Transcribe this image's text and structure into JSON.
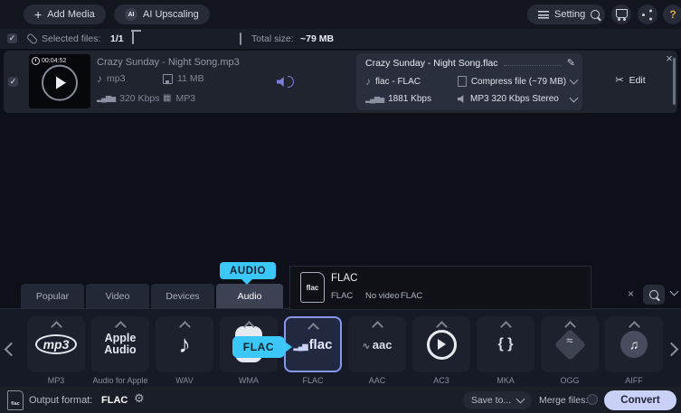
{
  "topbar": {
    "add_media": "Add Media",
    "ai_badge": "AI",
    "ai_upscaling": "AI Upscaling",
    "settings": "Settings",
    "help": "?"
  },
  "selection_bar": {
    "selected_files_label": "Selected files:",
    "selected_files_value": "1/1",
    "total_size_label": "Total size:",
    "total_size_value": "~79 MB"
  },
  "file_row": {
    "duration": "00:04:52",
    "title": "Crazy Sunday - Night Song.mp3",
    "format": "mp3",
    "size": "11 MB",
    "bitrate": "320 Kbps",
    "codec": "MP3"
  },
  "output_panel": {
    "filename": "Crazy Sunday - Night Song.flac",
    "format": "flac - FLAC",
    "compress": "Compress file (~79 MB)",
    "bitrate": "1881 Kbps",
    "audio_preset": "MP3 320 Kbps Stereo",
    "edit_label": "Edit",
    "close": "×"
  },
  "callouts": {
    "audio": "AUDIO",
    "flac": "FLAC"
  },
  "tabs": [
    {
      "label": "Popular",
      "active": false
    },
    {
      "label": "Video",
      "active": false
    },
    {
      "label": "Devices",
      "active": false
    },
    {
      "label": "Audio",
      "active": true
    }
  ],
  "format_tooltip": {
    "icon_label": "flac",
    "title": "FLAC",
    "container": "FLAC",
    "video": "No video",
    "audio": "FLAC"
  },
  "search": {
    "text": "...",
    "clear": "×"
  },
  "formats": [
    {
      "label": "MP3",
      "logo": "mp3",
      "kind": "mp3",
      "selected": false
    },
    {
      "label": "Audio for Apple",
      "logo": "Apple Audio",
      "kind": "apple",
      "selected": false
    },
    {
      "label": "WAV",
      "logo": "♪",
      "kind": "note",
      "selected": false
    },
    {
      "label": "WMA",
      "logo": "",
      "kind": "blob",
      "selected": false
    },
    {
      "label": "FLAC",
      "logo": "flac",
      "kind": "flac",
      "selected": true
    },
    {
      "label": "AAC",
      "logo": "aac",
      "kind": "aac",
      "selected": false
    },
    {
      "label": "AC3",
      "logo": "",
      "kind": "ac3",
      "selected": false
    },
    {
      "label": "MKA",
      "logo": "{ }",
      "kind": "mka",
      "selected": false
    },
    {
      "label": "OGG",
      "logo": "",
      "kind": "ogg",
      "selected": false
    },
    {
      "label": "AIFF",
      "logo": "♫",
      "kind": "aiff",
      "selected": false
    }
  ],
  "bottom_bar": {
    "file_badge": "flac",
    "output_format_label": "Output format:",
    "output_format_value": "FLAC",
    "save_to": "Save to...",
    "merge_files": "Merge files:",
    "convert": "Convert"
  }
}
